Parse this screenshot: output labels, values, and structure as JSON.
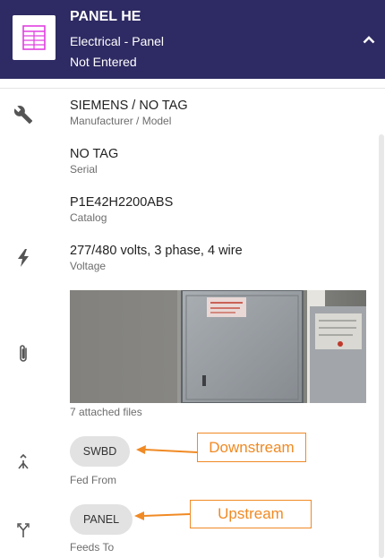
{
  "header": {
    "title": "PANEL HE",
    "type": "Electrical - Panel",
    "status": "Not Entered",
    "background_color": "#2e2a63",
    "icon": "panel-grid-icon",
    "icon_color": "#e040e0",
    "collapse_icon": "chevron-up-icon"
  },
  "fields": {
    "manufacturer": {
      "value": "SIEMENS / NO TAG",
      "label": "Manufacturer / Model",
      "icon": "wrench-icon"
    },
    "serial": {
      "value": "NO TAG",
      "label": "Serial"
    },
    "catalog": {
      "value": "P1E42H2200ABS",
      "label": "Catalog"
    },
    "voltage": {
      "value": "277/480 volts, 3 phase, 4 wire",
      "label": "Voltage",
      "icon": "lightning-bolt-icon"
    }
  },
  "attachments": {
    "caption": "7 attached files",
    "icon": "paperclip-icon"
  },
  "fed_from": {
    "chip": "SWBD",
    "label": "Fed From",
    "icon": "merge-arrow-icon",
    "annotation": "Downstream"
  },
  "feeds_to": {
    "chip": "PANEL",
    "label": "Feeds To",
    "icon": "split-arrow-icon",
    "annotation": "Upstream"
  },
  "colors": {
    "accent": "#f08a24",
    "chip_background": "#e2e2e2",
    "icon_gray": "#555555"
  }
}
